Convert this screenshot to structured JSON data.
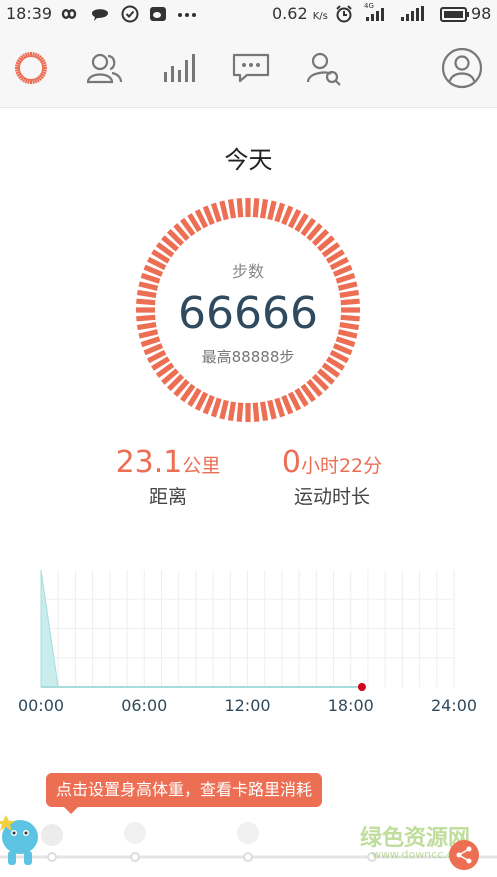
{
  "status_bar": {
    "time": "18:39",
    "speed": "0.62",
    "speed_unit": "K/s",
    "signal_tag": "4G",
    "battery": "98",
    "icons": [
      "infinity-icon",
      "chat-icon",
      "check-circle-icon",
      "weibo-icon",
      "more-dots-icon",
      "alarm-icon",
      "signal-icon",
      "battery-icon"
    ]
  },
  "nav": {
    "tabs": [
      "activity-ring-icon",
      "friends-icon",
      "stats-bars-icon",
      "messages-icon",
      "find-user-icon"
    ],
    "active_tab": "activity-ring-icon",
    "profile_icon": "user-avatar-icon"
  },
  "day": {
    "title": "今天"
  },
  "steps": {
    "label": "步数",
    "value": "66666",
    "best": "最高88888步",
    "ring_color": "#ec6e53"
  },
  "distance": {
    "value": "23.1",
    "unit": "公里",
    "caption": "距离"
  },
  "duration": {
    "hours": "0",
    "hours_unit": "小时",
    "minutes": "22",
    "minutes_unit": "分",
    "caption": "运动时长"
  },
  "chart_data": {
    "type": "area",
    "x": [
      "00:00",
      "01:00"
    ],
    "values": [
      100,
      0
    ],
    "xticks": [
      "00:00",
      "06:00",
      "12:00",
      "18:00",
      "24:00"
    ],
    "xlim": [
      0,
      24
    ],
    "ylim": [
      0,
      100
    ],
    "grid": true,
    "current_marker": "18:39",
    "fill_color": "#c9ecec",
    "marker_color": "#d0021b"
  },
  "tip": {
    "text": "点击设置身高体重，查看卡路里消耗"
  },
  "watermark": {
    "text": "绿色资源网",
    "url": "www.downcc.com"
  },
  "accent": "#ec6e53"
}
